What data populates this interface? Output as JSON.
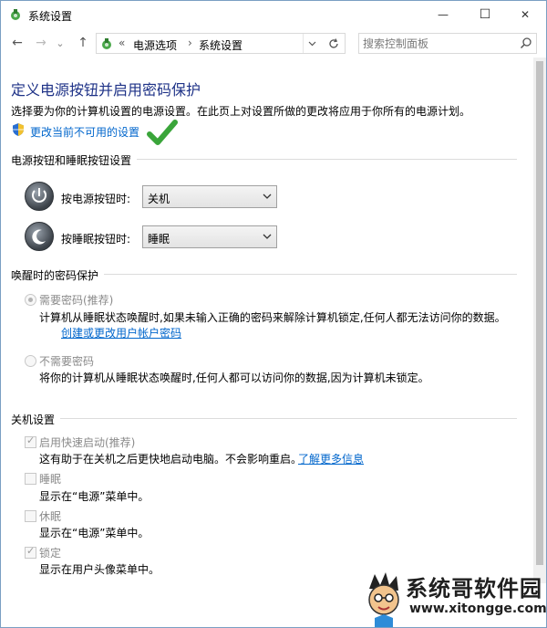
{
  "window": {
    "title": "系统设置",
    "minimize_glyph": "—",
    "maximize_glyph": "☐",
    "close_glyph": "✕"
  },
  "nav": {
    "back_glyph": "←",
    "forward_glyph": "→",
    "recent_glyph": "⌄",
    "up_glyph": "↑",
    "breadcrumb_prefix": "«",
    "breadcrumb": [
      "电源选项",
      "系统设置"
    ],
    "breadcrumb_sep": "›",
    "search_placeholder": "搜索控制面板"
  },
  "page": {
    "title": "定义电源按钮并启用密码保护",
    "description": "选择要为你的计算机设置的电源设置。在此页上对设置所做的更改将应用于你所有的电源计划。",
    "change_link": "更改当前不可用的设置"
  },
  "power_buttons": {
    "section_title": "电源按钮和睡眠按钮设置",
    "power": {
      "label": "按电源按钮时:",
      "value": "关机"
    },
    "sleep": {
      "label": "按睡眠按钮时:",
      "value": "睡眠"
    }
  },
  "wake_password": {
    "section_title": "唤醒时的密码保护",
    "require": {
      "label": "需要密码(推荐)",
      "desc": "计算机从睡眠状态唤醒时,如果未输入正确的密码来解除计算机锁定,任何人都无法访问你的数据。",
      "link": "创建或更改用户帐户密码",
      "selected": true
    },
    "no_require": {
      "label": "不需要密码",
      "desc": "将你的计算机从睡眠状态唤醒时,任何人都可以访问你的数据,因为计算机未锁定。",
      "selected": false
    }
  },
  "shutdown": {
    "section_title": "关机设置",
    "fast_startup": {
      "label": "启用快速启动(推荐)",
      "desc": "这有助于在关机之后更快地启动电脑。不会影响重启。",
      "link": "了解更多信息",
      "checked": true
    },
    "sleep": {
      "label": "睡眠",
      "desc": "显示在“电源”菜单中。",
      "checked": false
    },
    "hibernate": {
      "label": "休眠",
      "desc": "显示在“电源”菜单中。",
      "checked": false
    },
    "lock": {
      "label": "锁定",
      "desc": "显示在用户头像菜单中。",
      "checked": true
    }
  },
  "watermark": {
    "name": "系统哥软件园",
    "url": "www.xitongge.com"
  },
  "colors": {
    "title_blue": "#1e3287",
    "link_blue": "#0066cc",
    "check_green": "#3aa53a"
  }
}
